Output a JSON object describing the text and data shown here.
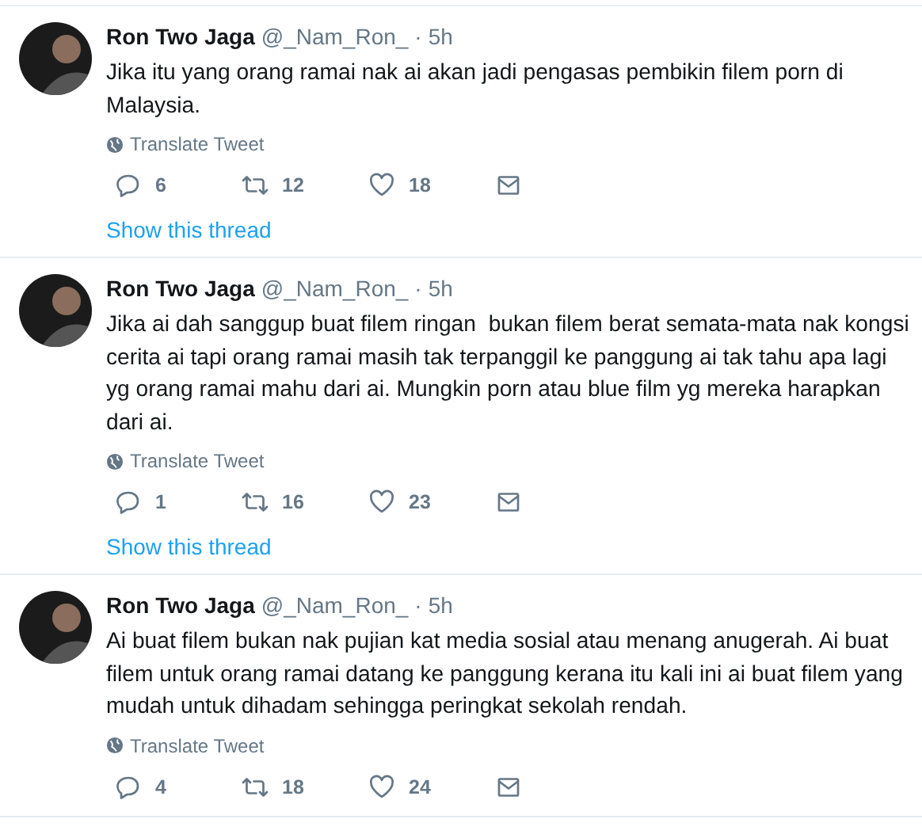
{
  "tweets": [
    {
      "name": "Ron Two Jaga",
      "handle": "@_Nam_Ron_",
      "separator": "·",
      "time": "5h",
      "lines": [
        "Jika itu yang orang ramai nak ai akan jadi pengasas pembikin filem porn di",
        "Malaysia."
      ],
      "translate": "Translate Tweet",
      "replies": "6",
      "retweets": "12",
      "likes": "18",
      "thread": "Show this thread"
    },
    {
      "name": "Ron Two Jaga",
      "handle": "@_Nam_Ron_",
      "separator": "·",
      "time": "5h",
      "lines": [
        "Jika ai dah sanggup buat filem ringan  bukan filem berat semata-mata nak kongsi",
        "cerita ai tapi orang ramai masih tak terpanggil ke panggung ai tak tahu apa lagi",
        "yg orang ramai mahu dari ai. Mungkin porn atau blue film yg mereka harapkan",
        "dari ai."
      ],
      "translate": "Translate Tweet",
      "replies": "1",
      "retweets": "16",
      "likes": "23",
      "thread": "Show this thread"
    },
    {
      "name": "Ron Two Jaga",
      "handle": "@_Nam_Ron_",
      "separator": "·",
      "time": "5h",
      "lines": [
        "Ai buat filem bukan nak pujian kat media sosial atau menang anugerah. Ai buat",
        "filem untuk orang ramai datang ke panggung kerana itu kali ini ai buat filem yang",
        "mudah untuk dihadam sehingga peringkat sekolah rendah."
      ],
      "translate": "Translate Tweet",
      "replies": "4",
      "retweets": "18",
      "likes": "24"
    }
  ]
}
